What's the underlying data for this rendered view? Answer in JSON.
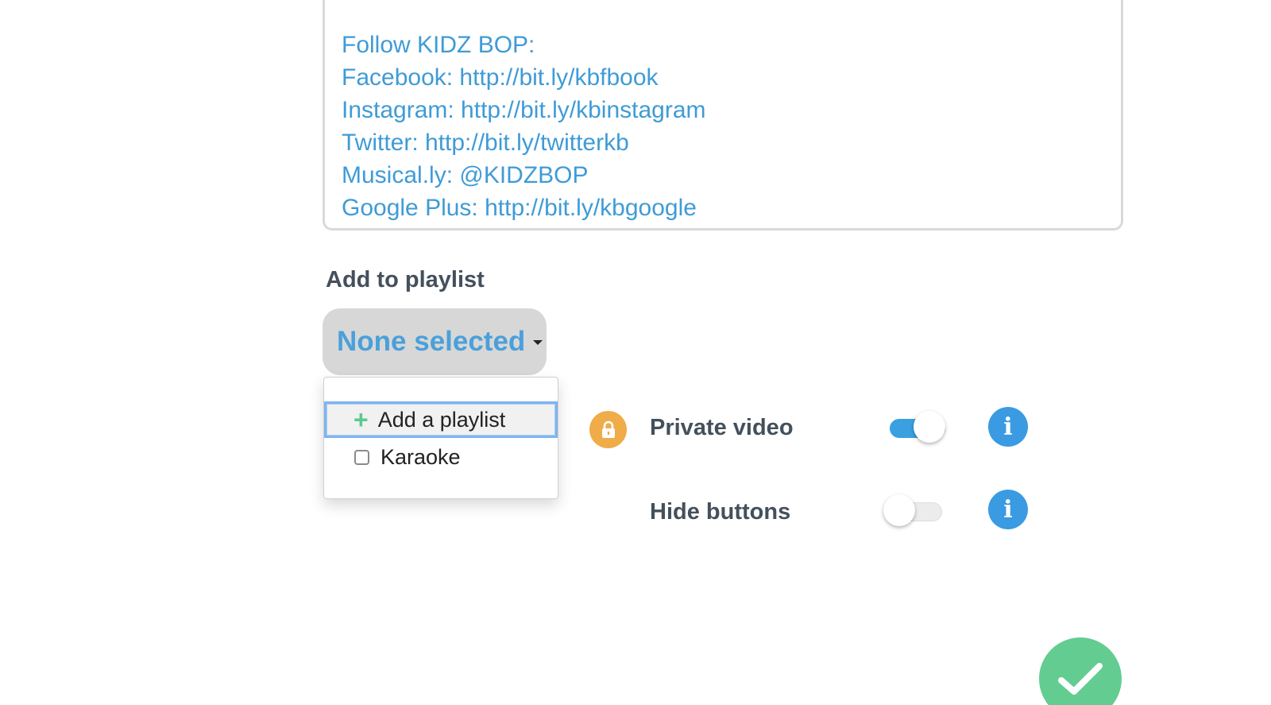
{
  "description": {
    "lines": [
      "Follow KIDZ BOP:",
      "Facebook: http://bit.ly/kbfbook",
      "Instagram: http://bit.ly/kbinstagram",
      "Twitter: http://bit.ly/twitterkb",
      "Musical.ly: @KIDZBOP",
      "Google Plus: http://bit.ly/kbgoogle"
    ]
  },
  "playlist": {
    "label": "Add to playlist",
    "selected": "None selected",
    "menu": {
      "add_label": "Add a playlist",
      "items": [
        {
          "label": "Karaoke",
          "checked": false
        }
      ]
    }
  },
  "options": {
    "private_video": {
      "label": "Private video",
      "enabled": true
    },
    "hide_buttons": {
      "label": "Hide buttons",
      "enabled": false
    }
  },
  "icons": {
    "lock": "lock-icon",
    "info": "info-icon",
    "confirm": "checkmark-icon",
    "add": "plus-icon"
  },
  "colors": {
    "link_text": "#3f9bd6",
    "accent_blue": "#3a9be2",
    "lock_orange": "#f0ac48",
    "confirm_green": "#63cc91",
    "plus_green": "#5cc98a"
  }
}
